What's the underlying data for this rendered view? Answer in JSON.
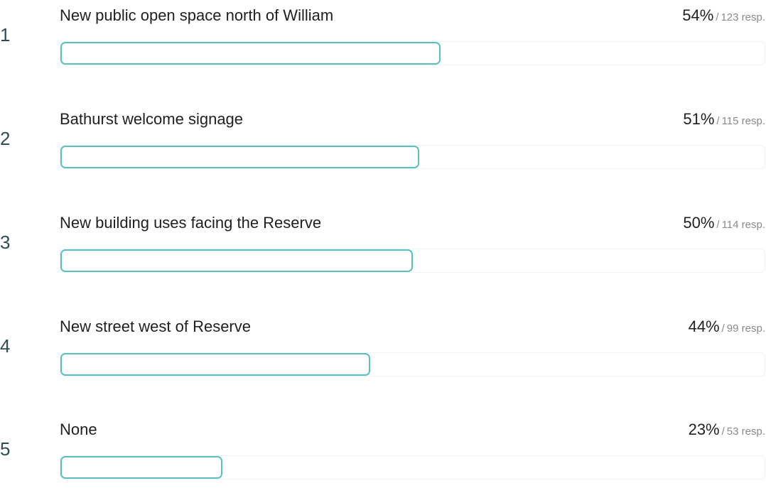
{
  "accent_color": "#5bbfbf",
  "rank_color": "#2f4f4f",
  "items": [
    {
      "rank": "1",
      "label": "New public open space north of William",
      "percent": "54%",
      "separator": "/",
      "responses": "123 resp.",
      "fraction": 0.54
    },
    {
      "rank": "2",
      "label": "Bathurst welcome signage",
      "percent": "51%",
      "separator": "/",
      "responses": "115 resp.",
      "fraction": 0.51
    },
    {
      "rank": "3",
      "label": "New building uses facing the Reserve",
      "percent": "50%",
      "separator": "/",
      "responses": "114 resp.",
      "fraction": 0.5
    },
    {
      "rank": "4",
      "label": "New street west of Reserve",
      "percent": "44%",
      "separator": "/",
      "responses": "99 resp.",
      "fraction": 0.44
    },
    {
      "rank": "5",
      "label": "None",
      "percent": "23%",
      "separator": "/",
      "responses": "53 resp.",
      "fraction": 0.23
    }
  ]
}
